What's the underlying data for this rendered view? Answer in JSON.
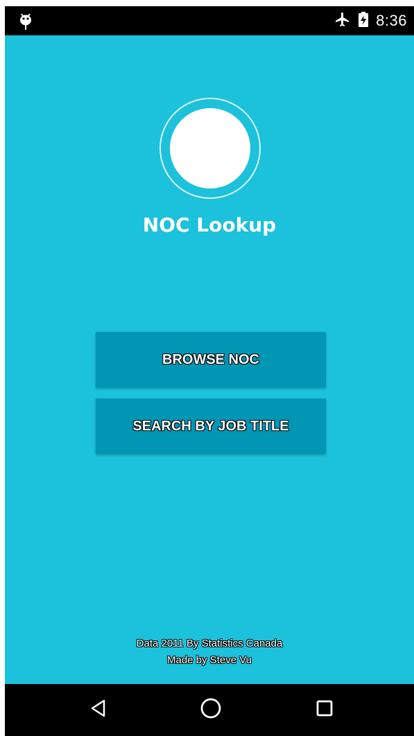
{
  "status_bar": {
    "time": "8:36",
    "left_icon": "android-debug-icon",
    "icons": [
      "airplane-icon",
      "battery-charging-icon"
    ]
  },
  "app": {
    "title": "NOC Lookup",
    "background_color": "#1CC1DB",
    "button_color": "#0096B4"
  },
  "buttons": {
    "browse_label": "BROWSE NOC",
    "search_label": "SEARCH BY JOB TITLE"
  },
  "footer": {
    "line1": "Data 2011 By Statistics Canada",
    "line2": "Made by Steve Vu"
  },
  "nav_bar": {
    "icons": [
      "back-icon",
      "home-icon",
      "recent-apps-icon"
    ]
  }
}
